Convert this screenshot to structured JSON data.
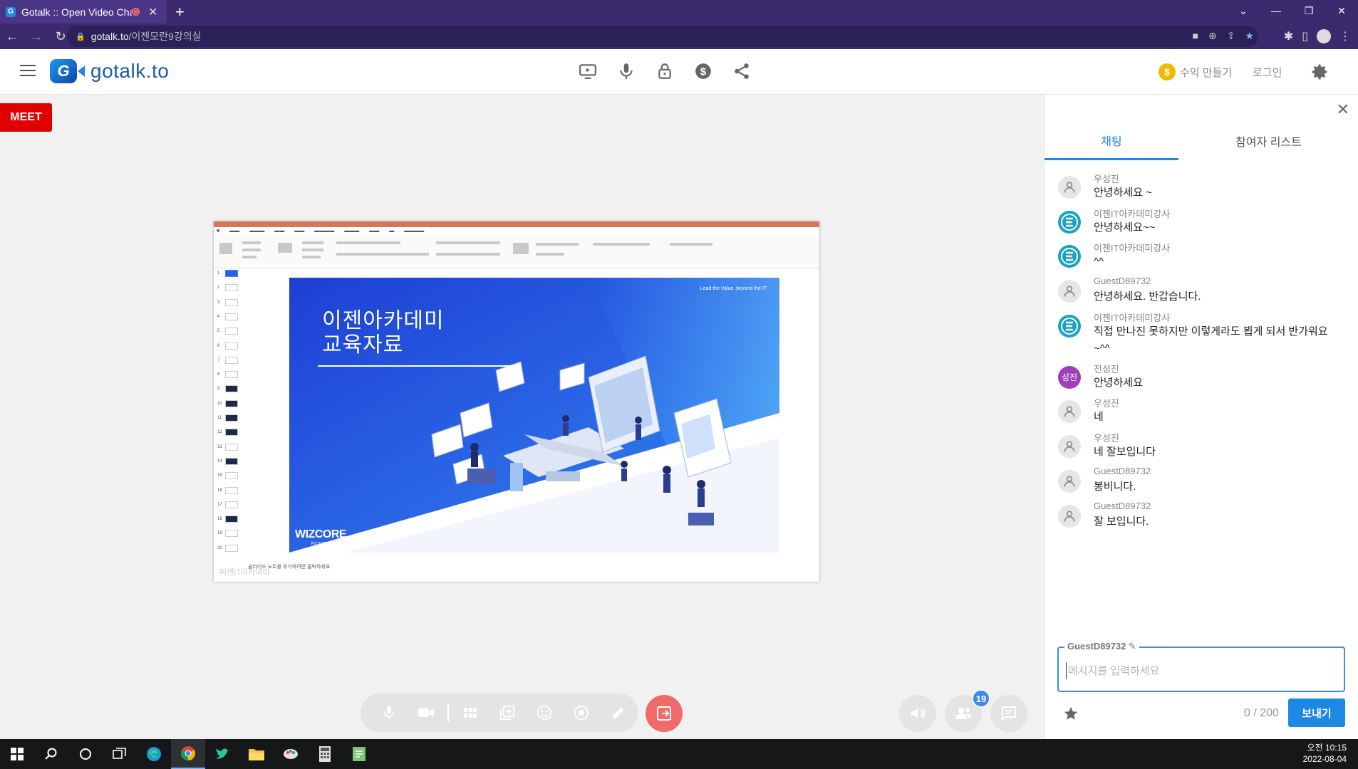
{
  "browser": {
    "tab_title": "Gotalk :: Open Video Chat",
    "tab_favicon": "G",
    "url_domain": "gotalk.to",
    "url_path": "/이젠모란9강의실"
  },
  "header": {
    "logo_text": "gotalk.to",
    "logo_mark": "G",
    "earn_label": "수익 만들기",
    "coin_symbol": "$",
    "login_label": "로그인"
  },
  "stage": {
    "meet_label": "MEET",
    "shared_slide": {
      "tagline": "Lead the Value, beyond the IT",
      "title_line1": "이젠아카데미",
      "title_line2": "교육자료",
      "brand": "WIZCORE",
      "brand_sub": "위즈코어주식회사",
      "watermark": "이젠IT아카데미",
      "notes_placeholder": "슬라이드 노트를 추가하려면 클릭하세요"
    },
    "participant_count": "19"
  },
  "chat": {
    "tabs": [
      {
        "label": "채팅",
        "active": true
      },
      {
        "label": "참여자 리스트",
        "active": false
      }
    ],
    "messages": [
      {
        "author": "우성진",
        "text": "안녕하세요 ~",
        "avatar": "default"
      },
      {
        "author": "이젠IT아카데미강사",
        "text": "안녕하세요~~",
        "avatar": "brand"
      },
      {
        "author": "이젠IT아카데미강사",
        "text": "^^",
        "avatar": "brand"
      },
      {
        "author": "GuestD89732",
        "text": "안녕하세요. 반갑습니다.",
        "avatar": "default"
      },
      {
        "author": "이젠IT아카데미강사",
        "text": "직접 만나진 못하지만 이렇게라도 뵙게 되서 반가워요~^^",
        "avatar": "brand"
      },
      {
        "author": "전성진",
        "text": "안녕하세요",
        "avatar": "purple",
        "initials": "성진"
      },
      {
        "author": "우성진",
        "text": "네",
        "avatar": "default"
      },
      {
        "author": "우성진",
        "text": "네 잘보입니다",
        "avatar": "default"
      },
      {
        "author": "GuestD89732",
        "text": "봉비니다.",
        "avatar": "default"
      },
      {
        "author": "GuestD89732",
        "text": "잘 보입니다.",
        "avatar": "default"
      }
    ],
    "username": "GuestD89732",
    "input_placeholder": "메시지를 입력하세요",
    "input_value": "",
    "counter": "0 / 200",
    "send_label": "보내기"
  },
  "taskbar": {
    "time": "오전 10:15",
    "date": "2022-08-04"
  },
  "colors": {
    "browser_frame": "#3b2a6e",
    "accent_blue": "#1e88e5",
    "meet_red": "#e00000",
    "leave_red": "#f06a6a",
    "brand_teal": "#19a2c9"
  }
}
